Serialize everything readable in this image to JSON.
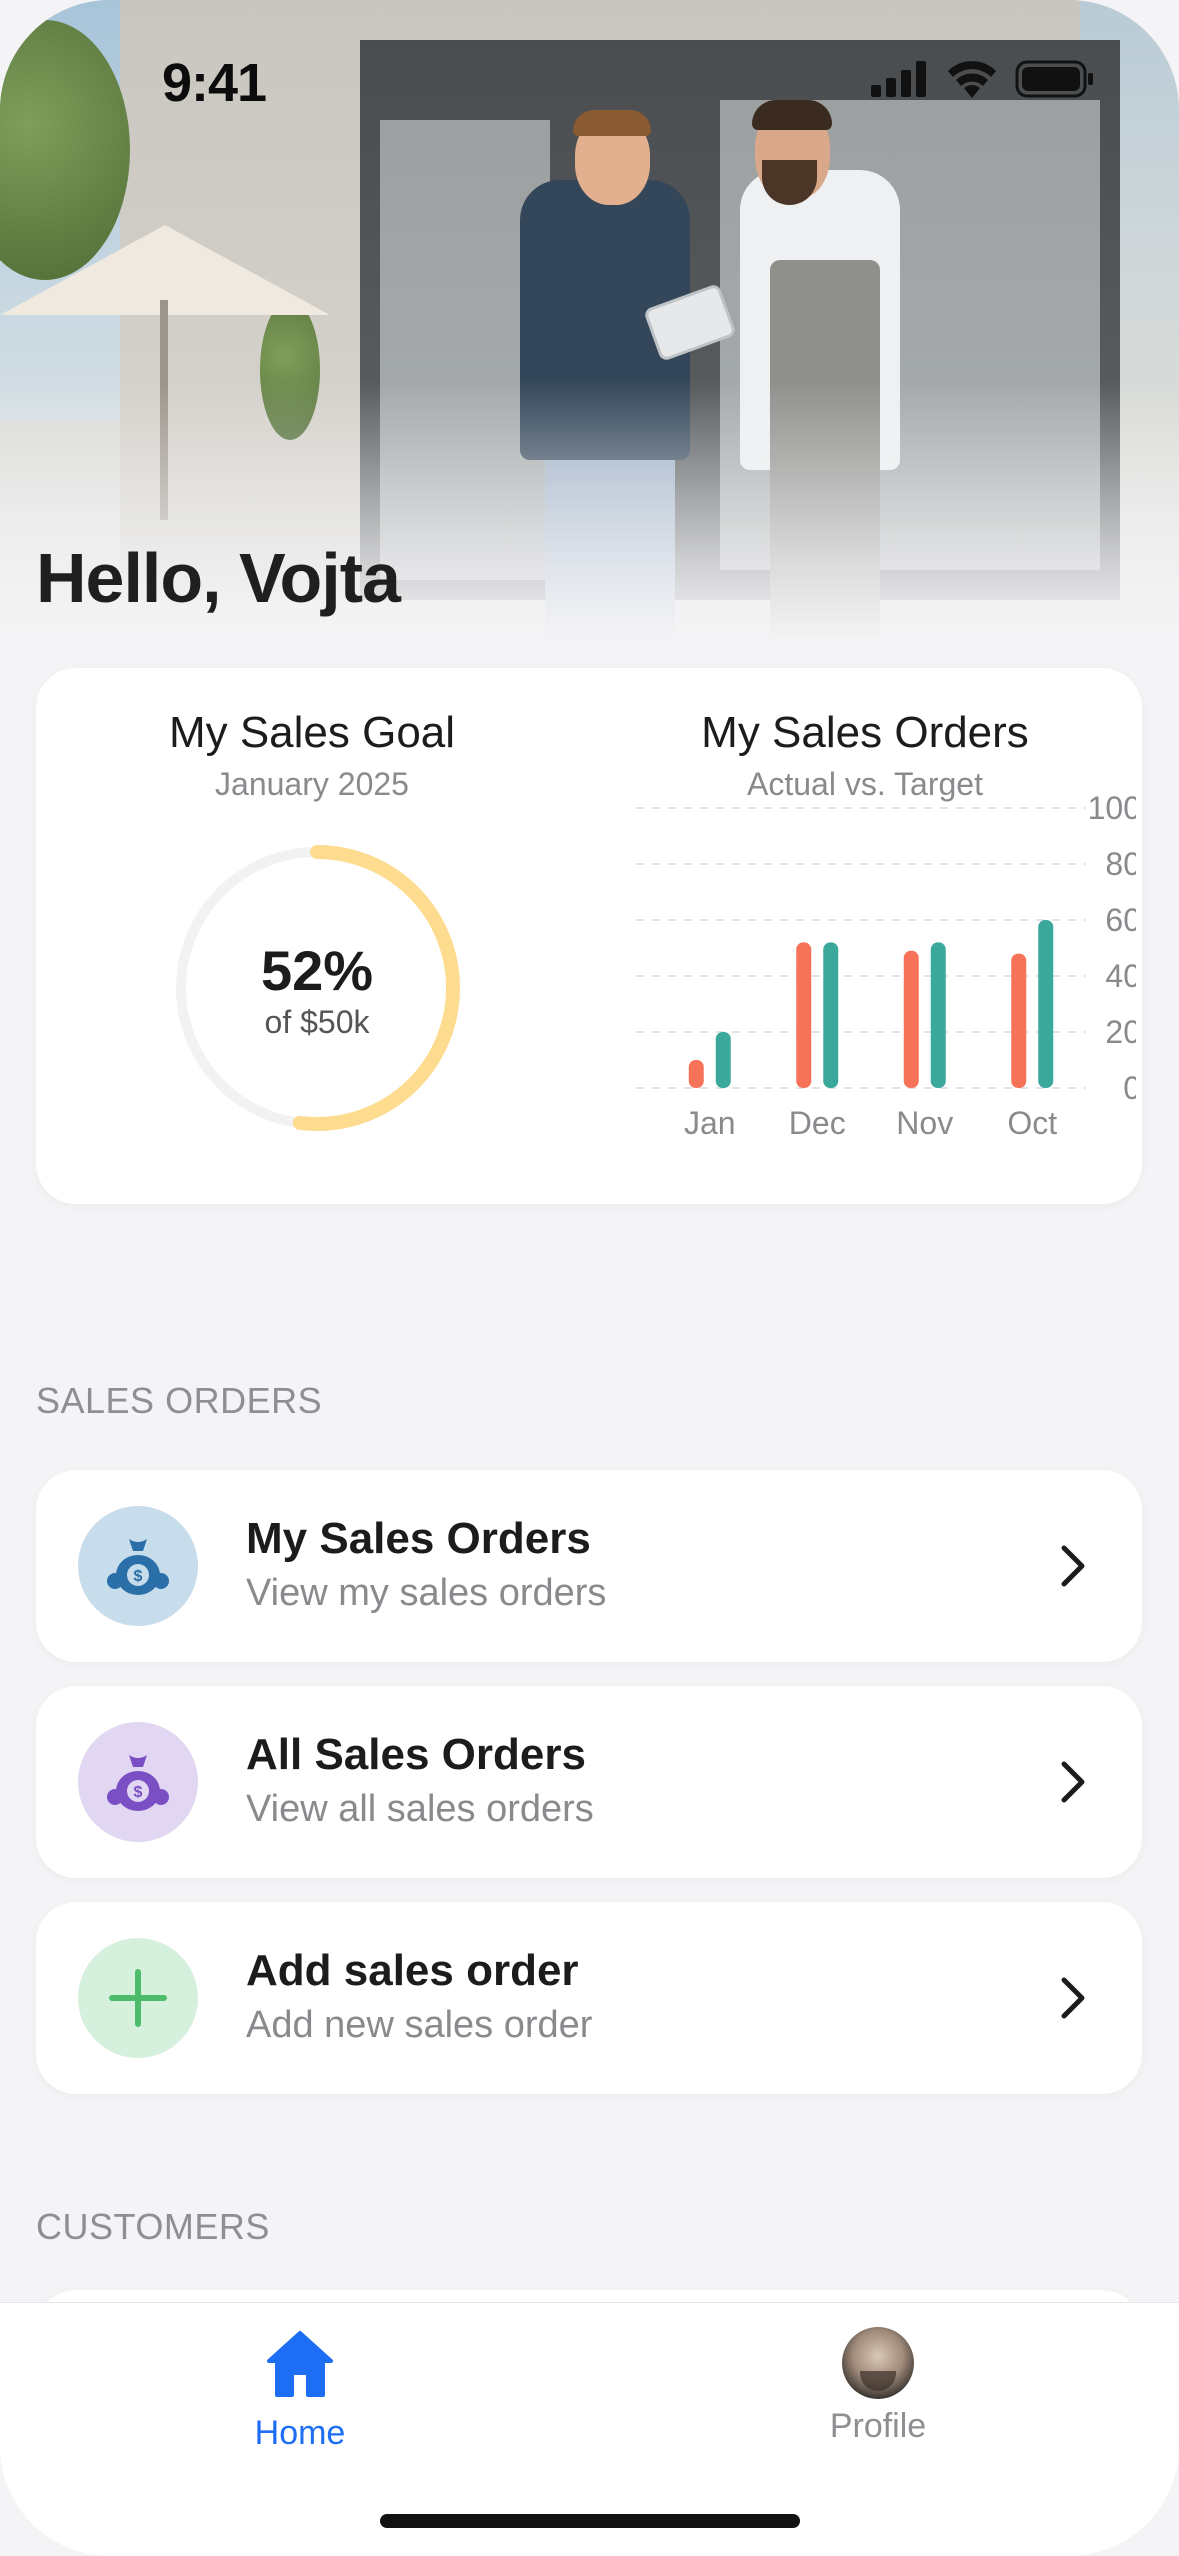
{
  "status_bar": {
    "time": "9:41"
  },
  "greeting": "Hello, Vojta",
  "sales_goal": {
    "title": "My Sales Goal",
    "subtitle": "January 2025",
    "percent_label": "52%",
    "percent_value": 52,
    "of_label": "of $50k",
    "ring_color": "#fddc8f",
    "track_color": "#f2f2f2"
  },
  "chart_data": {
    "type": "bar",
    "title": "My Sales Orders",
    "subtitle": "Actual vs. Target",
    "categories": [
      "Jan",
      "Dec",
      "Nov",
      "Oct"
    ],
    "series": [
      {
        "values": [
          10,
          52,
          49,
          48
        ],
        "color": "#f6735a"
      },
      {
        "values": [
          20,
          52,
          52,
          60
        ],
        "color": "#3aa99b"
      }
    ],
    "y_ticks": [
      "100",
      "80",
      "60",
      "40",
      "20",
      "0"
    ],
    "ylim": [
      0,
      100
    ],
    "y_axis_side": "right",
    "grid": "dashed"
  },
  "sections": {
    "sales_orders_label": "SALES ORDERS",
    "customers_label": "CUSTOMERS"
  },
  "rows": [
    {
      "title": "My Sales Orders",
      "subtitle": "View my sales orders",
      "icon": "money-bag-icon",
      "icon_bg": "#c7ddec",
      "icon_color": "#2b6fa8"
    },
    {
      "title": "All Sales Orders",
      "subtitle": "View all sales orders",
      "icon": "money-bag-icon",
      "icon_bg": "#e1d7f2",
      "icon_color": "#7a4fc4"
    },
    {
      "title": "Add sales order",
      "subtitle": "Add new sales order",
      "icon": "plus-icon",
      "icon_bg": "#d5f0dd",
      "icon_color": "#4cbc6b"
    }
  ],
  "tabbar": {
    "home_label": "Home",
    "profile_label": "Profile",
    "active_color": "#1e6ef5",
    "inactive_color": "#8e8e93"
  }
}
